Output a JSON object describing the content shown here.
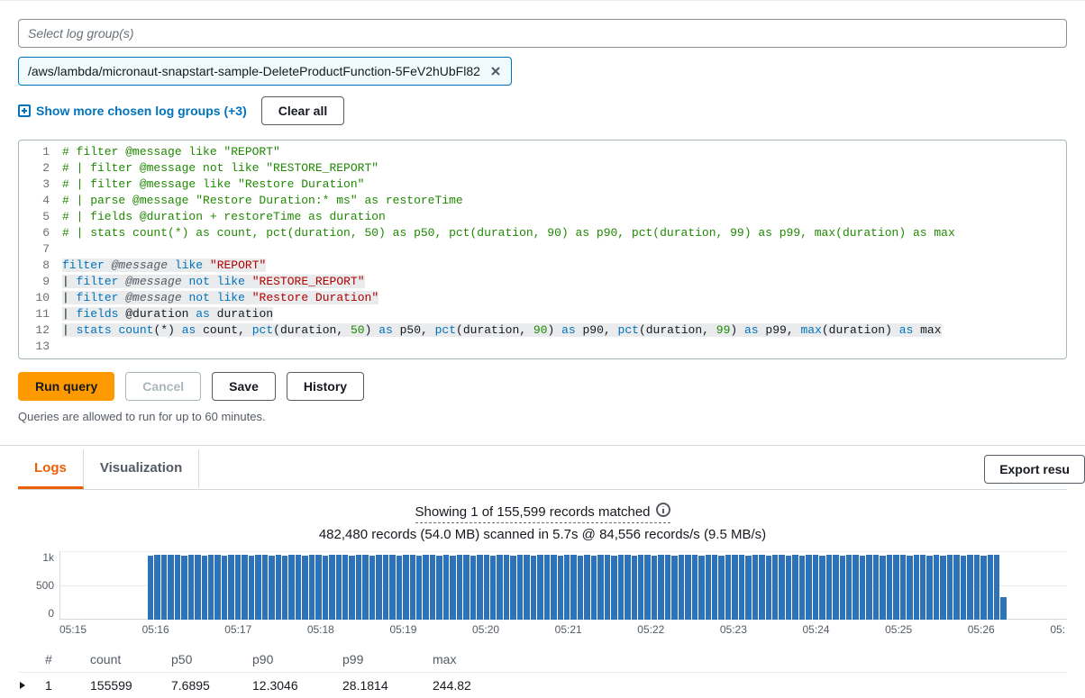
{
  "select_placeholder": "Select log group(s)",
  "chip": "/aws/lambda/micronaut-snapstart-sample-DeleteProductFunction-5FeV2hUbFl82",
  "show_more": "Show more chosen log groups (+3)",
  "clear_all": "Clear all",
  "editor_lines": [
    {
      "n": 1,
      "kind": "comment",
      "raw": "# filter @message like \"REPORT\""
    },
    {
      "n": 2,
      "kind": "comment",
      "raw": "# | filter @message not like \"RESTORE_REPORT\""
    },
    {
      "n": 3,
      "kind": "comment",
      "raw": "# | filter @message like \"Restore Duration\""
    },
    {
      "n": 4,
      "kind": "comment",
      "raw": "# | parse @message \"Restore Duration:* ms\" as restoreTime"
    },
    {
      "n": 5,
      "kind": "comment",
      "raw": "# | fields @duration + restoreTime as duration"
    },
    {
      "n": 6,
      "kind": "comment",
      "raw": "# | stats count(*) as count, pct(duration, 50) as p50, pct(duration, 90) as p90, pct(duration, 99) as p99, max(duration) as max"
    },
    {
      "n": 7,
      "kind": "blank",
      "raw": ""
    },
    {
      "n": 8,
      "kind": "code",
      "tokens": [
        [
          "key",
          "filter"
        ],
        [
          "plain",
          " "
        ],
        [
          "field",
          "@message"
        ],
        [
          "plain",
          " "
        ],
        [
          "key",
          "like"
        ],
        [
          "plain",
          " "
        ],
        [
          "str",
          "\"REPORT\""
        ]
      ]
    },
    {
      "n": 9,
      "kind": "code",
      "tokens": [
        [
          "plain",
          "| "
        ],
        [
          "key",
          "filter"
        ],
        [
          "plain",
          " "
        ],
        [
          "field",
          "@message"
        ],
        [
          "plain",
          " "
        ],
        [
          "key",
          "not"
        ],
        [
          "plain",
          " "
        ],
        [
          "key",
          "like"
        ],
        [
          "plain",
          " "
        ],
        [
          "str",
          "\"RESTORE_REPORT\""
        ]
      ]
    },
    {
      "n": 10,
      "kind": "code",
      "tokens": [
        [
          "plain",
          "| "
        ],
        [
          "key",
          "filter"
        ],
        [
          "plain",
          " "
        ],
        [
          "field",
          "@message"
        ],
        [
          "plain",
          " "
        ],
        [
          "key",
          "not"
        ],
        [
          "plain",
          " "
        ],
        [
          "key",
          "like"
        ],
        [
          "plain",
          " "
        ],
        [
          "str",
          "\"Restore Duration\""
        ]
      ]
    },
    {
      "n": 11,
      "kind": "code",
      "tokens": [
        [
          "plain",
          "| "
        ],
        [
          "key",
          "fields"
        ],
        [
          "plain",
          " @duration "
        ],
        [
          "key",
          "as"
        ],
        [
          "plain",
          " duration"
        ]
      ]
    },
    {
      "n": 12,
      "kind": "code",
      "tokens": [
        [
          "plain",
          "| "
        ],
        [
          "key",
          "stats"
        ],
        [
          "plain",
          " "
        ],
        [
          "key",
          "count"
        ],
        [
          "op",
          "("
        ],
        [
          "plain",
          "*"
        ],
        [
          "op",
          ") "
        ],
        [
          "key",
          "as"
        ],
        [
          "plain",
          " count"
        ],
        [
          "op",
          ", "
        ],
        [
          "key",
          "pct"
        ],
        [
          "op",
          "("
        ],
        [
          "plain",
          "duration"
        ],
        [
          "op",
          ", "
        ],
        [
          "num",
          "50"
        ],
        [
          "op",
          ") "
        ],
        [
          "key",
          "as"
        ],
        [
          "plain",
          " p50"
        ],
        [
          "op",
          ", "
        ],
        [
          "key",
          "pct"
        ],
        [
          "op",
          "("
        ],
        [
          "plain",
          "duration"
        ],
        [
          "op",
          ", "
        ],
        [
          "num",
          "90"
        ],
        [
          "op",
          ") "
        ],
        [
          "key",
          "as"
        ],
        [
          "plain",
          " p90"
        ],
        [
          "op",
          ", "
        ],
        [
          "key",
          "pct"
        ],
        [
          "op",
          "("
        ],
        [
          "plain",
          "duration"
        ],
        [
          "op",
          ", "
        ],
        [
          "num",
          "99"
        ],
        [
          "op",
          ") "
        ],
        [
          "key",
          "as"
        ],
        [
          "plain",
          " p99"
        ],
        [
          "op",
          ", "
        ],
        [
          "key",
          "max"
        ],
        [
          "op",
          "("
        ],
        [
          "plain",
          "duration"
        ],
        [
          "op",
          ") "
        ],
        [
          "key",
          "as"
        ],
        [
          "plain",
          " max"
        ]
      ]
    },
    {
      "n": 13,
      "kind": "blank",
      "raw": ""
    }
  ],
  "buttons": {
    "run_query": "Run query",
    "cancel": "Cancel",
    "save": "Save",
    "history": "History",
    "export": "Export resu"
  },
  "note": "Queries are allowed to run for up to 60 minutes.",
  "tabs": {
    "logs": "Logs",
    "visualization": "Visualization"
  },
  "summary": {
    "line1": "Showing 1 of 155,599 records matched",
    "line2": "482,480 records (54.0 MB) scanned in 5.7s @ 84,556 records/s (9.5 MB/s)"
  },
  "chart_data": {
    "type": "bar",
    "title": "",
    "xlabel": "",
    "ylabel": "",
    "ylim": [
      0,
      1200
    ],
    "y_ticks": [
      "1k",
      "500",
      "0"
    ],
    "x_ticks": [
      "05:15",
      "05:16",
      "05:17",
      "05:18",
      "05:19",
      "05:20",
      "05:21",
      "05:22",
      "05:23",
      "05:24",
      "05:25",
      "05:26",
      "05:"
    ],
    "values": [
      0,
      0,
      0,
      0,
      0,
      0,
      0,
      0,
      0,
      0,
      0,
      0,
      0,
      1120,
      1130,
      1140,
      1130,
      1140,
      1120,
      1130,
      1140,
      1120,
      1130,
      1140,
      1120,
      1130,
      1140,
      1130,
      1120,
      1130,
      1140,
      1120,
      1130,
      1120,
      1140,
      1130,
      1120,
      1130,
      1140,
      1120,
      1130,
      1140,
      1130,
      1120,
      1130,
      1140,
      1120,
      1130,
      1140,
      1130,
      1120,
      1130,
      1140,
      1120,
      1130,
      1140,
      1120,
      1130,
      1120,
      1140,
      1130,
      1120,
      1130,
      1140,
      1120,
      1130,
      1140,
      1120,
      1130,
      1140,
      1120,
      1130,
      1140,
      1130,
      1120,
      1130,
      1140,
      1120,
      1130,
      1120,
      1140,
      1130,
      1120,
      1130,
      1140,
      1120,
      1130,
      1140,
      1120,
      1130,
      1140,
      1120,
      1130,
      1140,
      1130,
      1120,
      1130,
      1140,
      1120,
      1130,
      1140,
      1130,
      1120,
      1130,
      1140,
      1120,
      1130,
      1140,
      1120,
      1130,
      1120,
      1140,
      1130,
      1120,
      1130,
      1140,
      1120,
      1130,
      1140,
      1120,
      1130,
      1140,
      1120,
      1130,
      1140,
      1130,
      1120,
      1130,
      1140,
      1120,
      1130,
      1120,
      1140,
      1130,
      1120,
      1130,
      1140,
      1120,
      1130,
      1140,
      400,
      0,
      0,
      0,
      0,
      0,
      0,
      0,
      0,
      0
    ]
  },
  "table": {
    "headers": [
      "#",
      "",
      "count",
      "p50",
      "p90",
      "p99",
      "max"
    ],
    "rows": [
      {
        "idx": "1",
        "count": "155599",
        "p50": "7.6895",
        "p90": "12.3046",
        "p99": "28.1814",
        "max": "244.82"
      }
    ]
  }
}
